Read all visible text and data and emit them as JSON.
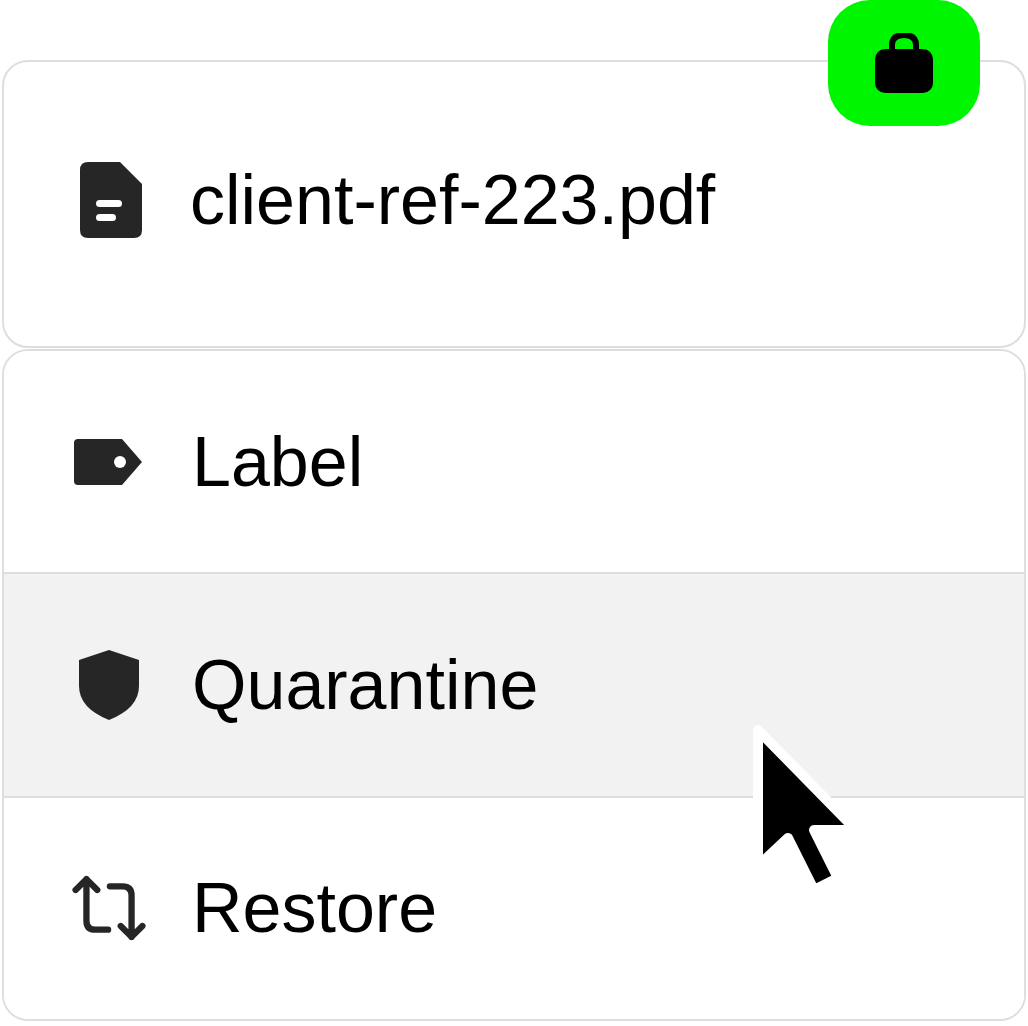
{
  "file": {
    "name": "client-ref-223.pdf"
  },
  "menu": {
    "items": [
      {
        "label": "Label",
        "selected": false
      },
      {
        "label": "Quarantine",
        "selected": true
      },
      {
        "label": "Restore",
        "selected": false
      }
    ]
  }
}
